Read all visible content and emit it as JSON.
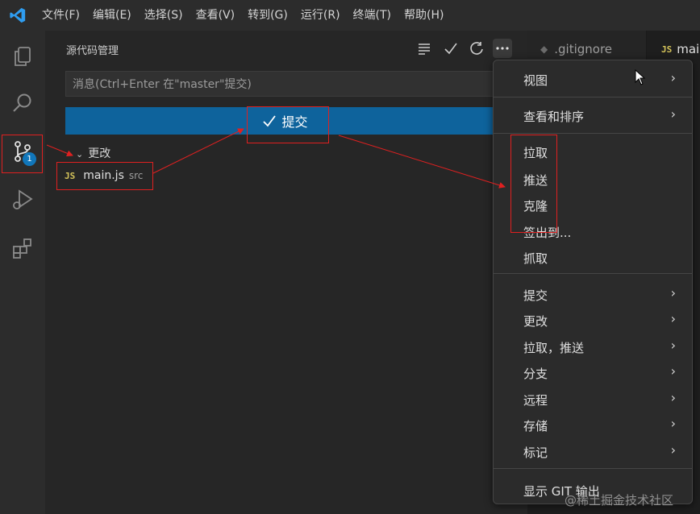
{
  "app": {
    "menu": [
      "文件(F)",
      "编辑(E)",
      "选择(S)",
      "查看(V)",
      "转到(G)",
      "运行(R)",
      "终端(T)",
      "帮助(H)"
    ]
  },
  "activity_bar": {
    "items": [
      "explorer-icon",
      "search-icon",
      "source-control-icon",
      "run-debug-icon",
      "extensions-icon"
    ],
    "scm_badge": "1"
  },
  "sidebar": {
    "title": "源代码管理",
    "commit_placeholder": "消息(Ctrl+Enter 在\"master\"提交)",
    "commit_button": "提交",
    "changes_label": "更改",
    "file": {
      "badge": "JS",
      "name": "main.js",
      "dir": "src"
    }
  },
  "tabs": [
    {
      "label": ".gitignore"
    },
    {
      "badge": "JS",
      "label": "mai"
    }
  ],
  "context_menu": {
    "items": [
      {
        "label": "视图",
        "submenu": true
      },
      {
        "label": "查看和排序",
        "submenu": true
      },
      {
        "label": "拉取",
        "submenu": false
      },
      {
        "label": "推送",
        "submenu": false
      },
      {
        "label": "克隆",
        "submenu": false
      },
      {
        "label": "签出到...",
        "submenu": false
      },
      {
        "label": "抓取",
        "submenu": false
      },
      {
        "label": "提交",
        "submenu": true
      },
      {
        "label": "更改",
        "submenu": true
      },
      {
        "label": "拉取，推送",
        "submenu": true
      },
      {
        "label": "分支",
        "submenu": true
      },
      {
        "label": "远程",
        "submenu": true
      },
      {
        "label": "存储",
        "submenu": true
      },
      {
        "label": "标记",
        "submenu": true
      },
      {
        "label": "显示 GIT 输出",
        "submenu": false
      }
    ]
  },
  "watermark": "@稀土掘金技术社区",
  "colors": {
    "accent": "#0e639c",
    "annotation": "#e02020",
    "badge": "#1177bb",
    "js": "#d4c35a"
  }
}
